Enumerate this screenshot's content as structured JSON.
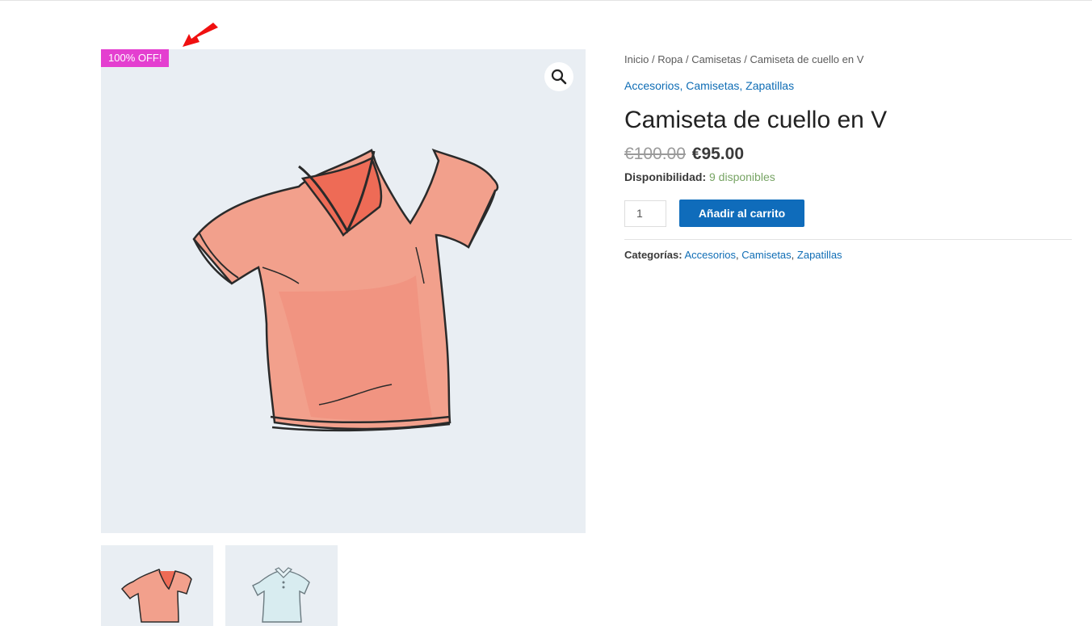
{
  "sale_badge": "100% OFF!",
  "zoom": {
    "icon": "magnifier-icon"
  },
  "breadcrumb": {
    "items": [
      "Inicio",
      "Ropa",
      "Camisetas"
    ],
    "current": "Camiseta de cuello en V",
    "separator": "/"
  },
  "category_links": [
    "Accesorios",
    "Camisetas",
    "Zapatillas"
  ],
  "product": {
    "title": "Camiseta de cuello en V",
    "regular_price": "€100.00",
    "sale_price": "€95.00",
    "stock_label": "Disponibilidad:",
    "stock_value": "9 disponibles"
  },
  "cart": {
    "quantity": "1",
    "add_to_cart_label": "Añadir al carrito"
  },
  "meta": {
    "categories_label": "Categorías:",
    "categories": [
      "Accesorios",
      "Camisetas",
      "Zapatillas"
    ]
  },
  "colors": {
    "accent": "#0f6cbb",
    "badge": "#e43fd0",
    "stock": "#77a464",
    "annotation_arrow": "#f01010"
  }
}
